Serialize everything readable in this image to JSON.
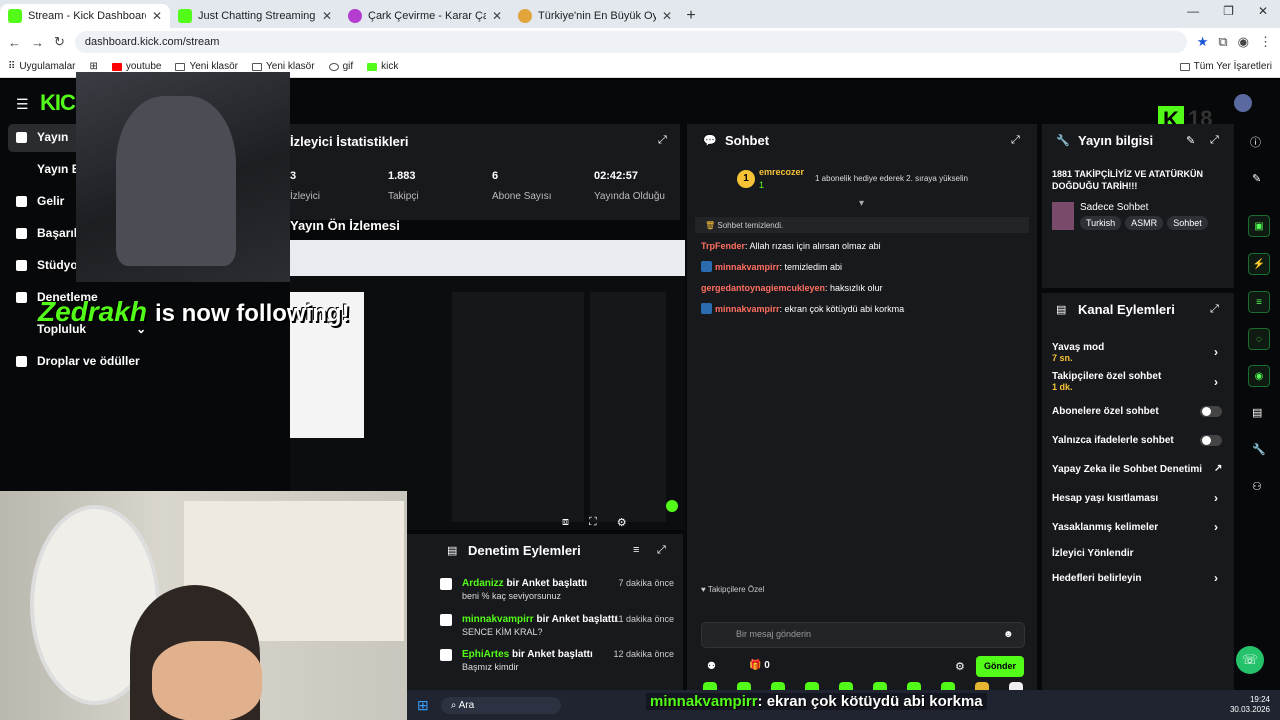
{
  "browser": {
    "tabs": [
      {
        "title": "Stream - Kick Dashboard",
        "active": true,
        "color": "#53fc18"
      },
      {
        "title": "Just Chatting Streaming - Live",
        "active": false,
        "color": "#53fc18"
      },
      {
        "title": "Çark Çevirme - Karar Çarkı",
        "active": false,
        "color": "#b43ccf"
      },
      {
        "title": "Türkiye'nin En Büyük Oyuncu D",
        "active": false,
        "color": "#e1a53a"
      }
    ],
    "url": "dashboard.kick.com/stream",
    "bookmarks": [
      "Uygulamalar",
      "youtube",
      "Yeni klasör",
      "Yeni klasör",
      "gif",
      "kick"
    ],
    "all_bookmarks": "Tüm Yer İşaretleri"
  },
  "app": {
    "logo": "KICK",
    "corner_badge": "18",
    "sidebar": [
      {
        "label": "Yayın",
        "icon": "broadcast-icon"
      },
      {
        "label": "Yayın Bağ",
        "icon": "link-icon"
      },
      {
        "label": "Gelir",
        "icon": "chart-icon"
      },
      {
        "label": "Başarıla",
        "icon": "trophy-icon"
      },
      {
        "label": "Stüdyo",
        "icon": "studio-icon"
      },
      {
        "label": "Denetleme",
        "icon": "wrench-icon"
      },
      {
        "label": "Topluluk",
        "icon": "community-icon"
      },
      {
        "label": "Droplar ve ödüller",
        "icon": "drops-icon"
      }
    ],
    "stats_panel": {
      "title": "İzleyici İstatistikleri",
      "stats": [
        {
          "value": "3",
          "label": "İzleyici"
        },
        {
          "value": "1.883",
          "label": "Takipçi"
        },
        {
          "value": "6",
          "label": "Abone Sayısı"
        },
        {
          "value": "02:42:57",
          "label": "Yayında Olduğu"
        }
      ]
    },
    "preview_title": "Yayın Ön İzlemesi",
    "chat": {
      "title": "Sohbet",
      "pinned_user": "emrecozer",
      "pinned_count": "1",
      "pinned_msg": "1 abonelik hediye ederek 2. sıraya yükselin",
      "cleared": "Sohbet temizlendi.",
      "messages": [
        {
          "user": "TrpFender",
          "color": "#ff6f61",
          "badge": false,
          "text": ": Allah rızası için alırsan olmaz abi"
        },
        {
          "user": "minnakvampirr",
          "color": "#ff6f61",
          "badge": true,
          "text": ": temizledim abi"
        },
        {
          "user": "gergedantoynagiemcukleyen",
          "color": "#ff6f61",
          "badge": false,
          "text": ": haksızlık olur"
        },
        {
          "user": "minnakvampirr",
          "color": "#ff6f61",
          "badge": true,
          "text": ": ekran çok kötüydü abi korkma"
        }
      ],
      "followers_only": "Takipçilere Özel",
      "input_placeholder": "Bir mesaj gönderin",
      "points": "0",
      "send": "Gönder"
    },
    "stream_info": {
      "title": "Yayın bilgisi",
      "stream_title": "1881 TAKİPÇİLİYİZ VE ATATÜRKÜN DOĞDUĞU TARİH!!!",
      "category": "Sadece Sohbet",
      "tags": [
        "Turkish",
        "ASMR",
        "Sohbet"
      ]
    },
    "channel_actions": {
      "title": "Kanal Eylemleri",
      "items": [
        {
          "label": "Yavaş mod",
          "sub": "7 sn.",
          "control": "chevron"
        },
        {
          "label": "Takipçilere özel sohbet",
          "sub": "1 dk.",
          "control": "chevron"
        },
        {
          "label": "Abonelere özel sohbet",
          "sub": "",
          "control": "toggle"
        },
        {
          "label": "Yalnızca ifadelerle sohbet",
          "sub": "",
          "control": "toggle"
        },
        {
          "label": "Yapay Zeka ile Sohbet Denetimi",
          "sub": "",
          "control": "external"
        },
        {
          "label": "Hesap yaşı kısıtlaması",
          "sub": "",
          "control": "chevron"
        },
        {
          "label": "Yasaklanmış kelimeler",
          "sub": "",
          "control": "chevron"
        },
        {
          "label": "İzleyici Yönlendir",
          "sub": "",
          "control": "none"
        },
        {
          "label": "Hedefleri belirleyin",
          "sub": "",
          "control": "chevron"
        }
      ]
    },
    "mod_actions": {
      "title": "Denetim Eylemleri",
      "items": [
        {
          "user": "Ardanizz",
          "action": " bir Anket başlattı",
          "detail": "beni % kaç seviyorsunuz",
          "time": "7 dakika önce"
        },
        {
          "user": "minnakvampirr",
          "action": " bir Anket başlattı",
          "detail": "SENCE KİM KRAL?",
          "time": "11 dakika önce"
        },
        {
          "user": "EphiArtes",
          "action": " bir Anket başlattı",
          "detail": "Başmız kimdir",
          "time": "12 dakika önce"
        }
      ]
    }
  },
  "overlay": {
    "follower": "Zedrakh",
    "follow_text": "is now following!",
    "tts_user": "minnakvampirr",
    "tts_text": ": ekran çok kötüydü abi korkma"
  },
  "taskbar": {
    "search": "Ara",
    "time": "19:24",
    "date": "30.03.2026"
  },
  "colors": {
    "accent": "#53fc18",
    "panel": "#18191c",
    "bg": "#070809"
  }
}
